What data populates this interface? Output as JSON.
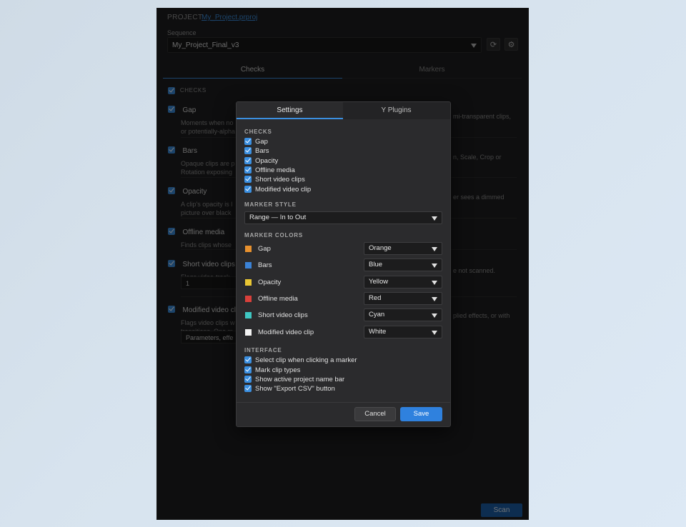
{
  "project": {
    "label": "PROJECT",
    "name": "My_Project.prproj"
  },
  "sequence": {
    "label": "Sequence",
    "value": "My_Project_Final_v3"
  },
  "tabs": [
    {
      "label": "Checks"
    },
    {
      "label": "Markers"
    }
  ],
  "checks_header": "CHECKS",
  "checks": [
    {
      "title": "Gap",
      "desc1": "Moments when no",
      "desc2": "or potentially-alpha",
      "desc_right": "mi-transparent clips,"
    },
    {
      "title": "Bars",
      "desc1": "Opaque clips are p",
      "desc2": "Rotation exposing",
      "desc_right": "n, Scale, Crop or"
    },
    {
      "title": "Opacity",
      "desc1": "A clip's opacity is l",
      "desc2": "picture over black",
      "desc_right": "er sees a dimmed"
    },
    {
      "title": "Offline media",
      "desc1": "Finds clips whose",
      "desc2": "",
      "desc_right": ""
    },
    {
      "title": "Short video clips",
      "desc1": "Flags video-track",
      "desc2": "",
      "desc_right": "e not scanned.",
      "input_value": "1"
    },
    {
      "title": "Modified video cli",
      "desc1": "Flags video clips w",
      "desc2": "transitions. One m",
      "desc_right": "plied effects, or with",
      "select_value": "Parameters, effe"
    }
  ],
  "scan_button": "Scan",
  "modal": {
    "tabs": [
      {
        "label": "Settings"
      },
      {
        "label": "Y Plugins"
      }
    ],
    "checks_section": "CHECKS",
    "checks": [
      "Gap",
      "Bars",
      "Opacity",
      "Offline media",
      "Short video clips",
      "Modified video clip"
    ],
    "marker_style_section": "MARKER STYLE",
    "marker_style_value": "Range — In to Out",
    "marker_colors_section": "MARKER COLORS",
    "marker_colors": [
      {
        "label": "Gap",
        "value": "Orange",
        "swatch": "#e8912e"
      },
      {
        "label": "Bars",
        "value": "Blue",
        "swatch": "#3b82d6"
      },
      {
        "label": "Opacity",
        "value": "Yellow",
        "swatch": "#e9c634"
      },
      {
        "label": "Offline media",
        "value": "Red",
        "swatch": "#d9403b"
      },
      {
        "label": "Short video clips",
        "value": "Cyan",
        "swatch": "#3fc7c2"
      },
      {
        "label": "Modified video clip",
        "value": "White",
        "swatch": "#f2f2f2"
      }
    ],
    "interface_section": "INTERFACE",
    "interface": [
      "Select clip when clicking a marker",
      "Mark clip types",
      "Show active project name bar",
      "Show \"Export CSV\" button"
    ],
    "cancel_label": "Cancel",
    "save_label": "Save"
  }
}
